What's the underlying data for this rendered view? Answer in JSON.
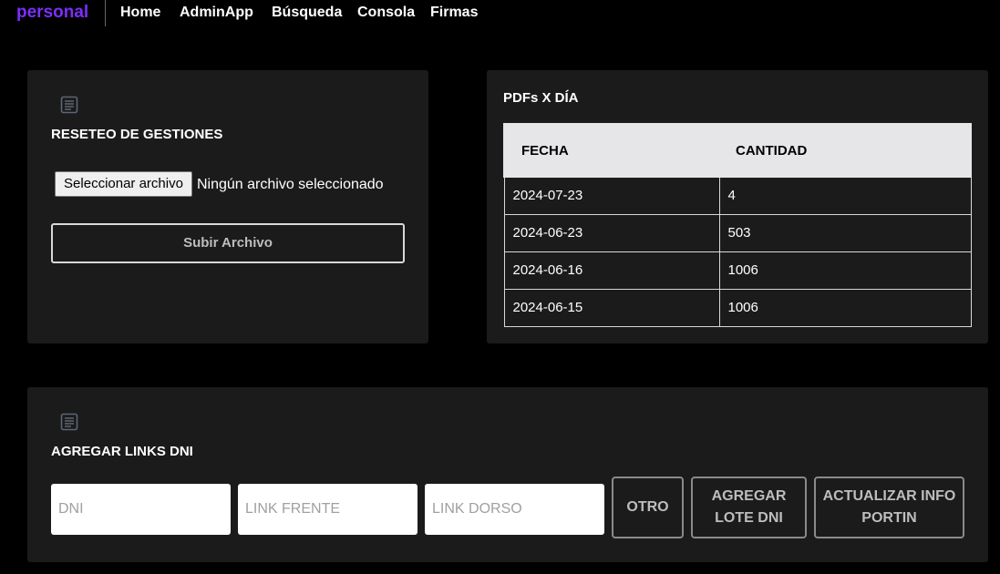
{
  "navbar": {
    "brand": "personal",
    "links": [
      "Home",
      "AdminApp",
      "Búsqueda",
      "Consola",
      "Firmas"
    ]
  },
  "reset_card": {
    "title": "RESETEO DE GESTIONES",
    "file_button_label": "Seleccionar archivo",
    "file_status": "Ningún archivo seleccionado",
    "upload_label": "Subir Archivo"
  },
  "pdf_card": {
    "title": "PDFs X DÍA",
    "headers": [
      "FECHA",
      "CANTIDAD"
    ],
    "rows": [
      [
        "2024-07-23",
        "4"
      ],
      [
        "2024-06-23",
        "503"
      ],
      [
        "2024-06-16",
        "1006"
      ],
      [
        "2024-06-15",
        "1006"
      ]
    ]
  },
  "links_card": {
    "title": "AGREGAR LINKS DNI",
    "dni_placeholder": "DNI",
    "front_placeholder": "LINK FRENTE",
    "back_placeholder": "LINK DORSO",
    "other_label": "OTRO",
    "batch_line1": "AGREGAR",
    "batch_line2": "LOTE DNI",
    "update_line1": "ACTUALIZAR INFO",
    "update_line2": "PORTIN"
  },
  "colors": {
    "brand": "#7b2ff7",
    "card_bg": "#1b1b1b",
    "page_bg": "#000000",
    "table_header_bg": "#e6e6e8"
  },
  "icons": {
    "card_icon": "document-lines-icon"
  }
}
